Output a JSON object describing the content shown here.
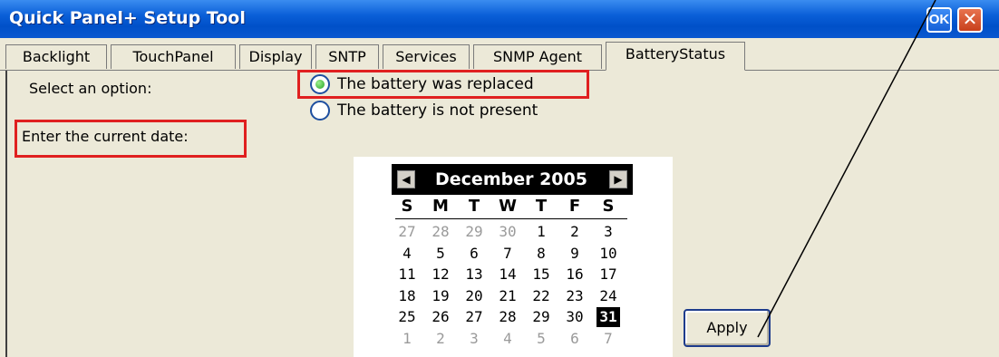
{
  "window": {
    "title": "Quick Panel+ Setup Tool",
    "ok_label": "OK",
    "close_label": "✕"
  },
  "tabs": [
    {
      "label": "Backlight"
    },
    {
      "label": "TouchPanel"
    },
    {
      "label": "Display"
    },
    {
      "label": "SNTP"
    },
    {
      "label": "Services"
    },
    {
      "label": "SNMP Agent"
    },
    {
      "label": "BatteryStatus",
      "active": true
    }
  ],
  "form": {
    "select_label": "Select an option:",
    "options": [
      {
        "label": "The battery was replaced",
        "selected": true
      },
      {
        "label": "The battery is not present",
        "selected": false
      }
    ],
    "date_label": "Enter the current date:"
  },
  "calendar": {
    "month_year": "December 2005",
    "prev_icon": "left-arrow-icon",
    "next_icon": "right-arrow-icon",
    "day_headers": [
      "S",
      "M",
      "T",
      "W",
      "T",
      "F",
      "S"
    ],
    "weeks": [
      [
        "27",
        "28",
        "29",
        "30",
        "1",
        "2",
        "3"
      ],
      [
        "4",
        "5",
        "6",
        "7",
        "8",
        "9",
        "10"
      ],
      [
        "11",
        "12",
        "13",
        "14",
        "15",
        "16",
        "17"
      ],
      [
        "18",
        "19",
        "20",
        "21",
        "22",
        "23",
        "24"
      ],
      [
        "25",
        "26",
        "27",
        "28",
        "29",
        "30",
        "31"
      ],
      [
        "1",
        "2",
        "3",
        "4",
        "5",
        "6",
        "7"
      ]
    ],
    "selected_day": "31"
  },
  "apply_label": "Apply",
  "colors": {
    "title_bar": "#0a5fd8",
    "highlight_box": "#e02020",
    "radio_selected": "#22a322"
  }
}
